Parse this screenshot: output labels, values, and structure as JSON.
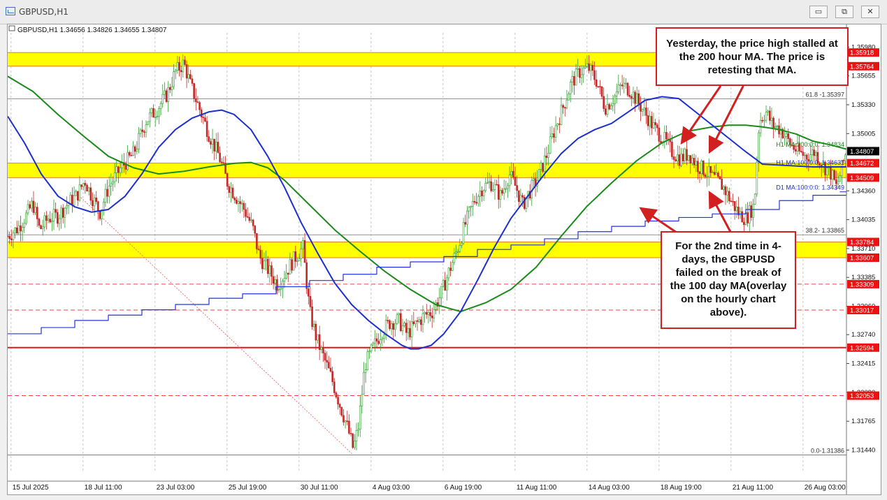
{
  "window": {
    "title": "GBPUSD,H1",
    "controls": {
      "minimize": "▭",
      "restore": "⧉",
      "close": "✕"
    }
  },
  "chart_info": "GBPUSD,H1  1.34656 1.34826 1.34655 1.34807",
  "annotations": {
    "top": "Yesterday, the price high stalled at the 200 hour MA. The price is retesting that MA.",
    "bottom": "For the 2nd time in 4-days, the GBPUSD failed on the break of the 100 day MA(overlay on the hourly chart above)."
  },
  "colors": {
    "zone_fill": "#ffff00",
    "ma200": "#1a8a1a",
    "ma100_hourly": "#1c2fd0",
    "d1_ma100": "#2233dd",
    "arrow": "#d21f1f",
    "bull_candle": "#2e9e2e",
    "bear_candle": "#c62828"
  },
  "chart_data": {
    "type": "candlestick",
    "symbol": "GBPUSD",
    "timeframe": "H1",
    "ylim": [
      1.312,
      1.3614
    ],
    "x_ticks": [
      "15 Jul 2025",
      "18 Jul 11:00",
      "23 Jul 03:00",
      "25 Jul 19:00",
      "30 Jul 11:00",
      "4 Aug 03:00",
      "6 Aug 19:00",
      "11 Aug 11:00",
      "14 Aug 03:00",
      "18 Aug 19:00",
      "21 Aug 11:00",
      "26 Aug 03:00"
    ],
    "y_ticks": [
      "1.35980",
      "1.35655",
      "1.35330",
      "1.35005",
      "1.34360",
      "1.34035",
      "1.33710",
      "1.33385",
      "1.33060",
      "1.32740",
      "1.32415",
      "1.32090",
      "1.31765",
      "1.31440"
    ],
    "price_labels": [
      {
        "text": "1.35918",
        "value": 1.35918,
        "style": "red"
      },
      {
        "text": "1.35764",
        "value": 1.35764,
        "style": "red"
      },
      {
        "text": "1.34807",
        "value": 1.34807,
        "style": "black"
      },
      {
        "text": "1.34672",
        "value": 1.34672,
        "style": "red"
      },
      {
        "text": "1.34509",
        "value": 1.34509,
        "style": "red"
      },
      {
        "text": "1.33784",
        "value": 1.33784,
        "style": "red"
      },
      {
        "text": "1.33607",
        "value": 1.33607,
        "style": "red"
      },
      {
        "text": "1.33309",
        "value": 1.33309,
        "style": "red"
      },
      {
        "text": "1.33017",
        "value": 1.33017,
        "style": "red"
      },
      {
        "text": "1.32594",
        "value": 1.32594,
        "style": "red"
      },
      {
        "text": "1.32053",
        "value": 1.32053,
        "style": "red"
      }
    ],
    "zones": [
      [
        1.35764,
        1.35918
      ],
      [
        1.34509,
        1.34672
      ],
      [
        1.33607,
        1.33784
      ]
    ],
    "hlines": [
      {
        "value": 1.35397,
        "style": "gray",
        "label": "61.8 -1.35397"
      },
      {
        "value": 1.34834,
        "style": "green",
        "label": "H1 MA:200:0:0: 1.34834"
      },
      {
        "value": 1.34631,
        "style": "blue",
        "label": "H1 MA:100:0:0: 1.34631"
      },
      {
        "value": 1.34349,
        "style": "blue",
        "label": "D1 MA:100:0:0: 1.34349"
      },
      {
        "value": 1.33865,
        "style": "gray",
        "label": "38.2- 1.33865"
      },
      {
        "value": 1.33309,
        "style": "reddash"
      },
      {
        "value": 1.33017,
        "style": "reddash"
      },
      {
        "value": 1.32594,
        "style": "red"
      },
      {
        "value": 1.32053,
        "style": "reddash"
      },
      {
        "value": 1.31386,
        "style": "gray",
        "label": "0.0-1.31386"
      }
    ],
    "price_path": [
      [
        0,
        1.3385
      ],
      [
        12,
        1.3394
      ],
      [
        22,
        1.3408
      ],
      [
        30,
        1.3422
      ],
      [
        38,
        1.3392
      ],
      [
        48,
        1.3405
      ],
      [
        60,
        1.3408
      ],
      [
        72,
        1.3422
      ],
      [
        82,
        1.343
      ],
      [
        92,
        1.3448
      ],
      [
        100,
        1.343
      ],
      [
        110,
        1.3412
      ],
      [
        120,
        1.344
      ],
      [
        135,
        1.3462
      ],
      [
        150,
        1.3478
      ],
      [
        165,
        1.3515
      ],
      [
        178,
        1.3528
      ],
      [
        190,
        1.3545
      ],
      [
        200,
        1.357
      ],
      [
        210,
        1.358
      ],
      [
        218,
        1.3555
      ],
      [
        228,
        1.353
      ],
      [
        240,
        1.35
      ],
      [
        252,
        1.3475
      ],
      [
        262,
        1.3445
      ],
      [
        272,
        1.343
      ],
      [
        282,
        1.3415
      ],
      [
        292,
        1.3395
      ],
      [
        300,
        1.3362
      ],
      [
        312,
        1.3345
      ],
      [
        322,
        1.333
      ],
      [
        332,
        1.3345
      ],
      [
        342,
        1.336
      ],
      [
        352,
        1.3372
      ],
      [
        360,
        1.33
      ],
      [
        368,
        1.327
      ],
      [
        376,
        1.325
      ],
      [
        386,
        1.3225
      ],
      [
        396,
        1.3195
      ],
      [
        405,
        1.317
      ],
      [
        412,
        1.3145
      ],
      [
        418,
        1.317
      ],
      [
        426,
        1.324
      ],
      [
        436,
        1.326
      ],
      [
        446,
        1.3278
      ],
      [
        456,
        1.3288
      ],
      [
        466,
        1.329
      ],
      [
        476,
        1.3275
      ],
      [
        486,
        1.3285
      ],
      [
        496,
        1.3295
      ],
      [
        506,
        1.33
      ],
      [
        516,
        1.3318
      ],
      [
        526,
        1.3345
      ],
      [
        536,
        1.337
      ],
      [
        546,
        1.34
      ],
      [
        556,
        1.3425
      ],
      [
        566,
        1.344
      ],
      [
        576,
        1.3445
      ],
      [
        588,
        1.343
      ],
      [
        598,
        1.3455
      ],
      [
        606,
        1.344
      ],
      [
        614,
        1.342
      ],
      [
        622,
        1.3435
      ],
      [
        632,
        1.345
      ],
      [
        642,
        1.3475
      ],
      [
        652,
        1.3505
      ],
      [
        662,
        1.353
      ],
      [
        672,
        1.3558
      ],
      [
        682,
        1.357
      ],
      [
        692,
        1.3575
      ],
      [
        702,
        1.356
      ],
      [
        712,
        1.353
      ],
      [
        722,
        1.354
      ],
      [
        732,
        1.3555
      ],
      [
        742,
        1.355
      ],
      [
        752,
        1.3535
      ],
      [
        762,
        1.352
      ],
      [
        772,
        1.3505
      ],
      [
        782,
        1.3495
      ],
      [
        792,
        1.348
      ],
      [
        802,
        1.3472
      ],
      [
        812,
        1.3478
      ],
      [
        822,
        1.3465
      ],
      [
        832,
        1.3458
      ],
      [
        842,
        1.345
      ],
      [
        852,
        1.3442
      ],
      [
        862,
        1.3425
      ],
      [
        872,
        1.341
      ],
      [
        880,
        1.3405
      ],
      [
        890,
        1.342
      ],
      [
        896,
        1.3515
      ],
      [
        904,
        1.3525
      ],
      [
        912,
        1.351
      ],
      [
        922,
        1.3505
      ],
      [
        932,
        1.349
      ],
      [
        942,
        1.348
      ],
      [
        952,
        1.3475
      ],
      [
        962,
        1.348
      ],
      [
        972,
        1.3465
      ],
      [
        982,
        1.3455
      ],
      [
        988,
        1.344
      ],
      [
        994,
        1.346
      ],
      [
        1000,
        1.3481
      ]
    ],
    "ma200_path": [
      [
        0,
        1.3565
      ],
      [
        30,
        1.3548
      ],
      [
        60,
        1.3522
      ],
      [
        90,
        1.3498
      ],
      [
        120,
        1.3475
      ],
      [
        150,
        1.3462
      ],
      [
        180,
        1.3455
      ],
      [
        210,
        1.3458
      ],
      [
        240,
        1.3463
      ],
      [
        270,
        1.3467
      ],
      [
        290,
        1.3468
      ],
      [
        310,
        1.3462
      ],
      [
        330,
        1.3448
      ],
      [
        360,
        1.342
      ],
      [
        390,
        1.3392
      ],
      [
        420,
        1.3368
      ],
      [
        450,
        1.3345
      ],
      [
        480,
        1.3325
      ],
      [
        510,
        1.3308
      ],
      [
        540,
        1.33
      ],
      [
        570,
        1.331
      ],
      [
        600,
        1.3325
      ],
      [
        630,
        1.335
      ],
      [
        660,
        1.3385
      ],
      [
        690,
        1.3418
      ],
      [
        720,
        1.3445
      ],
      [
        750,
        1.347
      ],
      [
        780,
        1.349
      ],
      [
        810,
        1.3503
      ],
      [
        840,
        1.3508
      ],
      [
        860,
        1.351
      ],
      [
        880,
        1.351
      ],
      [
        900,
        1.3508
      ],
      [
        920,
        1.3505
      ],
      [
        940,
        1.35
      ],
      [
        960,
        1.3492
      ],
      [
        980,
        1.3488
      ],
      [
        1000,
        1.3483
      ]
    ],
    "ma100_path": [
      [
        0,
        1.352
      ],
      [
        20,
        1.349
      ],
      [
        40,
        1.3455
      ],
      [
        60,
        1.343
      ],
      [
        80,
        1.3418
      ],
      [
        100,
        1.3412
      ],
      [
        120,
        1.3415
      ],
      [
        140,
        1.343
      ],
      [
        160,
        1.3455
      ],
      [
        180,
        1.3485
      ],
      [
        200,
        1.3505
      ],
      [
        220,
        1.3518
      ],
      [
        240,
        1.3525
      ],
      [
        255,
        1.3527
      ],
      [
        270,
        1.3522
      ],
      [
        290,
        1.3505
      ],
      [
        310,
        1.3475
      ],
      [
        330,
        1.344
      ],
      [
        350,
        1.34
      ],
      [
        370,
        1.3365
      ],
      [
        390,
        1.3332
      ],
      [
        410,
        1.3308
      ],
      [
        430,
        1.329
      ],
      [
        450,
        1.3275
      ],
      [
        470,
        1.3262
      ],
      [
        480,
        1.3258
      ],
      [
        490,
        1.3258
      ],
      [
        505,
        1.3262
      ],
      [
        520,
        1.3275
      ],
      [
        540,
        1.33
      ],
      [
        560,
        1.3335
      ],
      [
        580,
        1.3372
      ],
      [
        600,
        1.3405
      ],
      [
        620,
        1.343
      ],
      [
        640,
        1.3455
      ],
      [
        660,
        1.3478
      ],
      [
        680,
        1.3495
      ],
      [
        700,
        1.3505
      ],
      [
        720,
        1.3512
      ],
      [
        740,
        1.3525
      ],
      [
        760,
        1.3538
      ],
      [
        780,
        1.3542
      ],
      [
        800,
        1.354
      ],
      [
        820,
        1.3525
      ],
      [
        840,
        1.351
      ],
      [
        860,
        1.3495
      ],
      [
        880,
        1.348
      ],
      [
        900,
        1.3466
      ],
      [
        920,
        1.3465
      ],
      [
        940,
        1.3464
      ],
      [
        960,
        1.3463
      ],
      [
        980,
        1.3463
      ],
      [
        1000,
        1.3463
      ]
    ],
    "d1_ma100_steps": [
      [
        0,
        1.3275
      ],
      [
        40,
        1.3282
      ],
      [
        80,
        1.329
      ],
      [
        120,
        1.3296
      ],
      [
        160,
        1.3302
      ],
      [
        200,
        1.3308
      ],
      [
        240,
        1.3315
      ],
      [
        280,
        1.332
      ],
      [
        320,
        1.3328
      ],
      [
        360,
        1.3335
      ],
      [
        400,
        1.3342
      ],
      [
        440,
        1.335
      ],
      [
        480,
        1.3356
      ],
      [
        520,
        1.3362
      ],
      [
        560,
        1.337
      ],
      [
        600,
        1.3375
      ],
      [
        640,
        1.3382
      ],
      [
        680,
        1.339
      ],
      [
        720,
        1.3396
      ],
      [
        760,
        1.3402
      ],
      [
        800,
        1.3406
      ],
      [
        840,
        1.341
      ],
      [
        880,
        1.3415
      ],
      [
        920,
        1.3425
      ],
      [
        960,
        1.3431
      ],
      [
        1000,
        1.3435
      ]
    ]
  }
}
